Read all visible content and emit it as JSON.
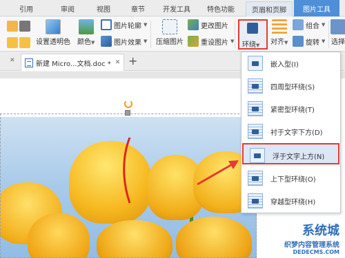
{
  "tabs": [
    "引用",
    "审阅",
    "视图",
    "章节",
    "开发工具",
    "特色功能",
    "页眉和页脚",
    "图片工具"
  ],
  "ribbon": {
    "set_transparent": "设置透明色",
    "color": "颜色",
    "picture_outline": "图片轮廓",
    "picture_effect": "图片效果",
    "compress": "压缩图片",
    "change_picture": "更改图片",
    "reset_picture": "重设图片",
    "wrap": "环绕",
    "align": "对齐",
    "group": "组合",
    "rotate": "旋转",
    "select": "选择"
  },
  "doc_tab": {
    "title": "新建 Micro...文档.doc *",
    "new_tab": "+"
  },
  "wrap_menu": [
    {
      "label": "嵌入型(I)"
    },
    {
      "label": "四周型环绕(S)"
    },
    {
      "label": "紧密型环绕(T)"
    },
    {
      "label": "衬于文字下方(D)"
    },
    {
      "label": "浮于文字上方(N)"
    },
    {
      "label": "上下型环绕(O)"
    },
    {
      "label": "穿越型环绕(H)"
    }
  ],
  "watermark": {
    "big": "系统城",
    "small": "织梦内容管理系统",
    "tiny": "DEDECMS.COM"
  },
  "colors": {
    "accent": "#4e8fd8",
    "highlight": "#e53a2f"
  }
}
